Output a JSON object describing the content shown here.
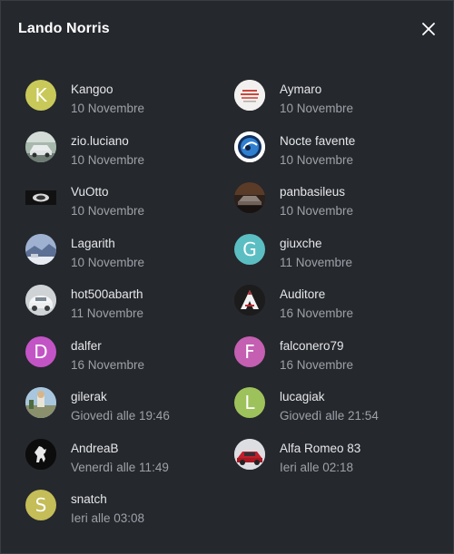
{
  "dialog": {
    "title": "Lando Norris",
    "close_label": "close"
  },
  "people": [
    {
      "name": "Kangoo",
      "date": "10 Novembre",
      "avatar": {
        "type": "letter",
        "letter": "K",
        "color": "#c9c95a"
      }
    },
    {
      "name": "Aymaro",
      "date": "10 Novembre",
      "avatar": {
        "type": "image",
        "icon": "document-thumbnail"
      }
    },
    {
      "name": "zio.luciano",
      "date": "10 Novembre",
      "avatar": {
        "type": "image",
        "icon": "car-photo"
      }
    },
    {
      "name": "Nocte favente",
      "date": "10 Novembre",
      "avatar": {
        "type": "image",
        "icon": "blue-circle-logo"
      }
    },
    {
      "name": "VuOtto",
      "date": "10 Novembre",
      "avatar": {
        "type": "image",
        "icon": "dark-logo"
      }
    },
    {
      "name": "panbasileus",
      "date": "10 Novembre",
      "avatar": {
        "type": "image",
        "icon": "dark-car-photo"
      }
    },
    {
      "name": "Lagarith",
      "date": "10 Novembre",
      "avatar": {
        "type": "image",
        "icon": "landscape-photo"
      }
    },
    {
      "name": "giuxche",
      "date": "11 Novembre",
      "avatar": {
        "type": "letter",
        "letter": "G",
        "color": "#5bbec3"
      }
    },
    {
      "name": "hot500abarth",
      "date": "11 Novembre",
      "avatar": {
        "type": "image",
        "icon": "white-car-photo"
      }
    },
    {
      "name": "Auditore",
      "date": "16 Novembre",
      "avatar": {
        "type": "image",
        "icon": "assassin-logo"
      }
    },
    {
      "name": "dalfer",
      "date": "16 Novembre",
      "avatar": {
        "type": "letter",
        "letter": "D",
        "color": "#c354c6"
      }
    },
    {
      "name": "falconero79",
      "date": "16 Novembre",
      "avatar": {
        "type": "letter",
        "letter": "F",
        "color": "#c45fb2"
      }
    },
    {
      "name": "gilerak",
      "date": "Giovedì alle 19:46",
      "avatar": {
        "type": "image",
        "icon": "outdoor-photo"
      }
    },
    {
      "name": "lucagiak",
      "date": "Giovedì alle 21:54",
      "avatar": {
        "type": "letter",
        "letter": "L",
        "color": "#9ec25b"
      }
    },
    {
      "name": "AndreaB",
      "date": "Venerdì alle 11:49",
      "avatar": {
        "type": "image",
        "icon": "prancing-horse-logo"
      }
    },
    {
      "name": "Alfa Romeo 83",
      "date": "Ieri alle 02:18",
      "avatar": {
        "type": "image",
        "icon": "red-car-photo"
      }
    },
    {
      "name": "snatch",
      "date": "Ieri alle 03:08",
      "avatar": {
        "type": "letter",
        "letter": "S",
        "color": "#c4bd58"
      }
    }
  ]
}
